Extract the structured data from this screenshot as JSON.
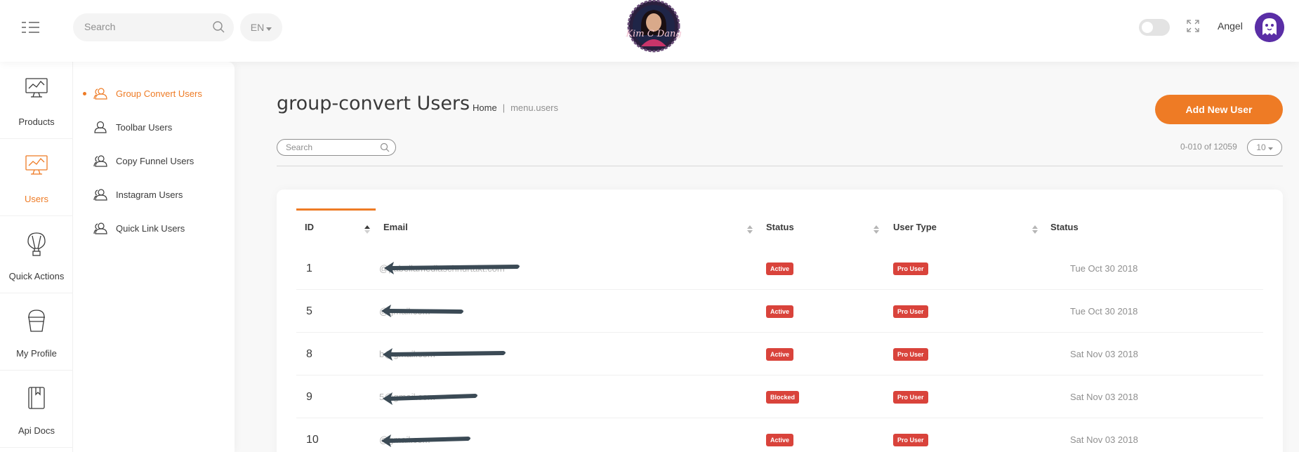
{
  "topbar": {
    "search_placeholder": "Search",
    "language": "EN",
    "username": "Angel",
    "icons": [
      "menu-icon",
      "search-icon",
      "theme-toggle",
      "fullscreen-icon",
      "user-avatar"
    ]
  },
  "main_menu": {
    "items": [
      {
        "label": "Products",
        "icon": "monitor-chart-icon",
        "active": false
      },
      {
        "label": "Users",
        "icon": "monitor-chart-icon",
        "active": true
      },
      {
        "label": "Quick Actions",
        "icon": "balloon-icon",
        "active": false
      },
      {
        "label": "My Profile",
        "icon": "bucket-icon",
        "active": false
      },
      {
        "label": "Api Docs",
        "icon": "book-icon",
        "active": false
      }
    ]
  },
  "sub_menu": {
    "items": [
      {
        "label": "Group Convert Users",
        "icon": "users-icon",
        "active": true
      },
      {
        "label": "Toolbar Users",
        "icon": "user-icon",
        "active": false
      },
      {
        "label": "Copy Funnel Users",
        "icon": "users-icon",
        "active": false
      },
      {
        "label": "Instagram Users",
        "icon": "users-icon",
        "active": false
      },
      {
        "label": "Quick Link Users",
        "icon": "users-icon",
        "active": false
      }
    ]
  },
  "page": {
    "title": "group-convert Users",
    "breadcrumb": {
      "home": "Home",
      "separator": "|",
      "current": "menu.users"
    },
    "add_button": "Add New User",
    "search_placeholder": "Search",
    "pager_text": "0-010 of 12059",
    "page_size": "10"
  },
  "table": {
    "columns": [
      "ID",
      "Email",
      "Status",
      "User Type",
      "Status"
    ],
    "rows": [
      {
        "id": "1",
        "email": "@pabellamediaschnurtakt.com",
        "status": "Active",
        "user_type": "Pro User",
        "date": "Tue Oct 30 2018"
      },
      {
        "id": "5",
        "email": "@gmail.com",
        "status": "Active",
        "user_type": "Pro User",
        "date": "Tue Oct 30 2018"
      },
      {
        "id": "8",
        "email": "b@gmail.com",
        "status": "Active",
        "user_type": "Pro User",
        "date": "Sat Nov 03 2018"
      },
      {
        "id": "9",
        "email": "5@gmail.com",
        "status": "Blocked",
        "user_type": "Pro User",
        "date": "Sat Nov 03 2018"
      },
      {
        "id": "10",
        "email": "@gmail.com",
        "status": "Active",
        "user_type": "Pro User",
        "date": "Sat Nov 03 2018"
      }
    ]
  },
  "colors": {
    "accent": "#ee7b25",
    "badge": "#d9433b",
    "text": "#3a3a3a",
    "muted": "#8f8f8f",
    "redaction": "#3b4a55"
  }
}
